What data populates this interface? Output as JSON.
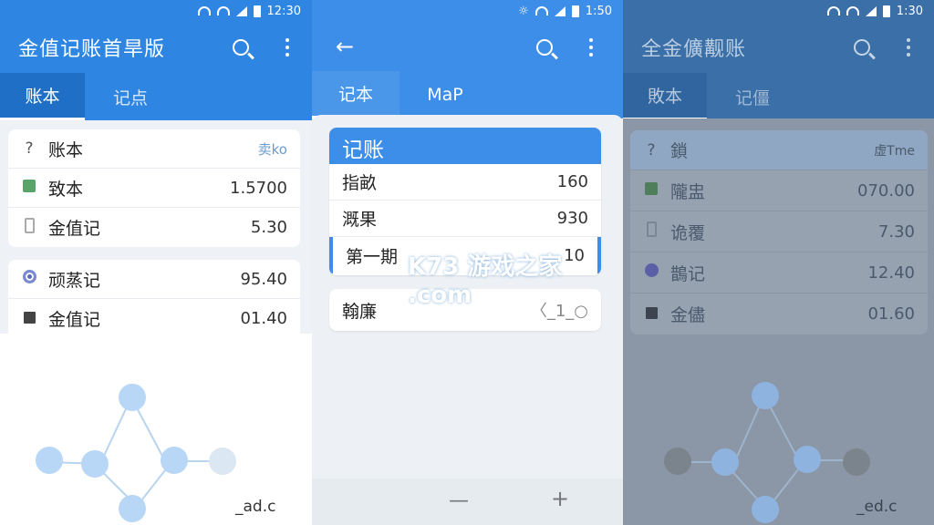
{
  "colors": {
    "primary": "#2f86e2",
    "tab_bg": "#1f6fc7",
    "accent": "#3d8ee8",
    "node": "#b9d7f4"
  },
  "screens": [
    {
      "time": "12:30",
      "title": "金值记账首旱版",
      "tabs": [
        "账本",
        "记点"
      ],
      "list1": [
        {
          "icon": "question-icon",
          "label": "账本",
          "value": "卖ko"
        },
        {
          "icon": "flag-icon",
          "label": "致本",
          "value": "1.5700"
        },
        {
          "icon": "document-icon",
          "label": "金值记",
          "value": "5.30"
        }
      ],
      "list2": [
        {
          "icon": "radio-icon",
          "label": "顽蒸记",
          "value": "95.40"
        },
        {
          "icon": "flag-icon",
          "label": "金值记",
          "value": "01.40"
        }
      ],
      "footer": "_ad.c"
    },
    {
      "time": "1:50",
      "tabs": [
        "记本",
        "MaP"
      ],
      "section_title": "记账",
      "rows": [
        {
          "label": "指畝",
          "value": "160"
        },
        {
          "label": "溉果",
          "value": "930"
        },
        {
          "label": "第一期",
          "value": "10"
        }
      ],
      "input": {
        "label": "翰廉",
        "value": "〈_1_○"
      },
      "watermark": "K73 游戏之家 .com",
      "bottom": {
        "minus": "—",
        "plus": "+"
      }
    },
    {
      "time": "1:30",
      "title": "全金儣觏账",
      "tabs": [
        "敗本",
        "记僵"
      ],
      "rows": [
        {
          "icon": "question-icon",
          "label": "鎖",
          "value": "虚Tme"
        },
        {
          "icon": "flag-icon",
          "label": "隴盅",
          "value": "070.00"
        },
        {
          "icon": "document-icon",
          "label": "诡覆",
          "value": "7.30"
        },
        {
          "icon": "radio-icon",
          "label": "鵲记",
          "value": "12.40"
        },
        {
          "icon": "flag-icon",
          "label": "金儘",
          "value": "01.60"
        }
      ],
      "footer": "_ed.c"
    }
  ]
}
